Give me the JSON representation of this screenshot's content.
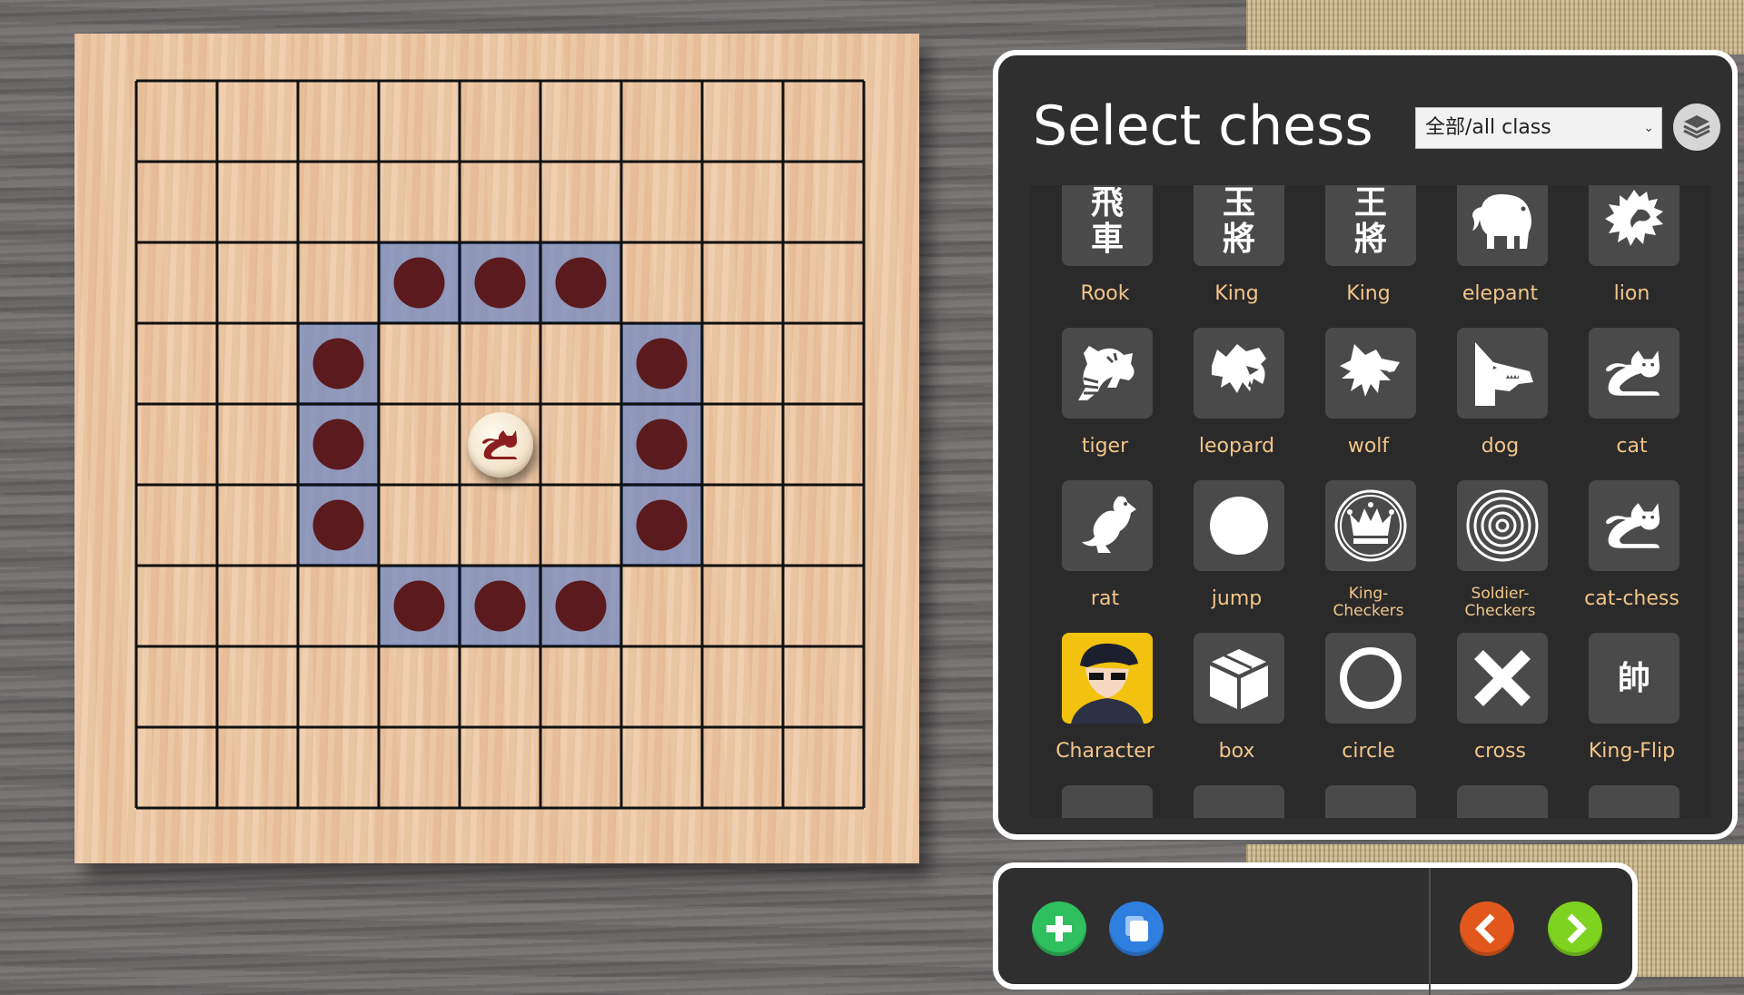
{
  "panel": {
    "title": "Select chess",
    "filter_value": "全部/all class",
    "layers_icon": "layers-icon"
  },
  "board": {
    "cols": 9,
    "rows": 9,
    "selected_piece": "cat",
    "selected_piece_cell": {
      "col": 4,
      "row": 4
    },
    "highlight_cells": [
      {
        "col": 3,
        "row": 2
      },
      {
        "col": 4,
        "row": 2
      },
      {
        "col": 5,
        "row": 2
      },
      {
        "col": 2,
        "row": 3
      },
      {
        "col": 6,
        "row": 3
      },
      {
        "col": 2,
        "row": 4
      },
      {
        "col": 6,
        "row": 4
      },
      {
        "col": 2,
        "row": 5
      },
      {
        "col": 6,
        "row": 5
      },
      {
        "col": 3,
        "row": 6
      },
      {
        "col": 4,
        "row": 6
      },
      {
        "col": 5,
        "row": 6
      }
    ],
    "colors": {
      "highlight": "#6c86c4",
      "dot": "#5b1a1e",
      "cat_icon": "#8a1e1e"
    }
  },
  "pieces": [
    {
      "label": "Rook",
      "icon": "kanji-rook",
      "glyph": "飛\n車"
    },
    {
      "label": "King",
      "icon": "kanji-king-jade",
      "glyph": "玉\n將"
    },
    {
      "label": "King",
      "icon": "kanji-king",
      "glyph": "王\n將"
    },
    {
      "label": "elepant",
      "icon": "elephant-icon"
    },
    {
      "label": "lion",
      "icon": "lion-icon"
    },
    {
      "label": "tiger",
      "icon": "tiger-icon"
    },
    {
      "label": "leopard",
      "icon": "leopard-icon"
    },
    {
      "label": "wolf",
      "icon": "wolf-icon"
    },
    {
      "label": "dog",
      "icon": "dog-icon"
    },
    {
      "label": "cat",
      "icon": "cat-icon"
    },
    {
      "label": "rat",
      "icon": "rat-icon"
    },
    {
      "label": "jump",
      "icon": "filled-circle-icon"
    },
    {
      "label": "King-\nCheckers",
      "icon": "crown-checker-icon"
    },
    {
      "label": "Soldier-\nCheckers",
      "icon": "soldier-checker-icon"
    },
    {
      "label": "cat-chess",
      "icon": "cat-icon"
    },
    {
      "label": "Character",
      "icon": "character-portrait"
    },
    {
      "label": "box",
      "icon": "box-icon"
    },
    {
      "label": "circle",
      "icon": "ring-icon"
    },
    {
      "label": "cross",
      "icon": "cross-icon"
    },
    {
      "label": "King-Flip",
      "icon": "kanji-king-flip",
      "glyph": "帥"
    }
  ],
  "toolbar": {
    "add_icon": "plus-icon",
    "copy_icon": "copy-icon",
    "prev_icon": "chevron-left-icon",
    "next_icon": "chevron-right-icon",
    "colors": {
      "add": "#2fbf5e",
      "copy": "#2f7fe0",
      "prev": "#e2581c",
      "next": "#7ed321"
    }
  }
}
